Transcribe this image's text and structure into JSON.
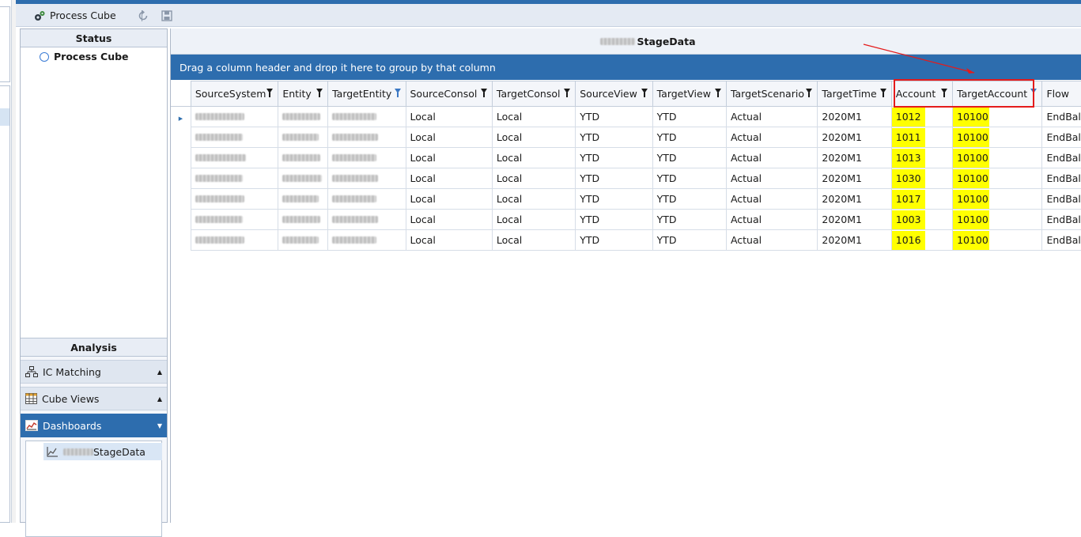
{
  "toolbar": {
    "process_cube_label": "Process Cube"
  },
  "status_panel": {
    "header": "Status",
    "item_label": "Process Cube"
  },
  "analysis_panel": {
    "header": "Analysis",
    "items": [
      {
        "label": "IC Matching",
        "icon": "network-icon"
      },
      {
        "label": "Cube Views",
        "icon": "grid-table-icon"
      },
      {
        "label": "Dashboards",
        "icon": "chart-icon"
      }
    ],
    "dashboard_item_suffix": "StageData"
  },
  "main": {
    "title_suffix": "StageData",
    "group_hint": "Drag a column header and drop it here to group by that column",
    "columns": [
      "SourceSystem",
      "Entity",
      "TargetEntity",
      "SourceConsol",
      "TargetConsol",
      "SourceView",
      "TargetView",
      "TargetScenario",
      "TargetTime",
      "Account",
      "TargetAccount",
      "Flow"
    ],
    "rows": [
      {
        "source_consol": "Local",
        "target_consol": "Local",
        "source_view": "YTD",
        "target_view": "YTD",
        "scenario": "Actual",
        "time": "2020M1",
        "account": "1012",
        "target_account": "10100",
        "flow": "EndBal"
      },
      {
        "source_consol": "Local",
        "target_consol": "Local",
        "source_view": "YTD",
        "target_view": "YTD",
        "scenario": "Actual",
        "time": "2020M1",
        "account": "1011",
        "target_account": "10100",
        "flow": "EndBal"
      },
      {
        "source_consol": "Local",
        "target_consol": "Local",
        "source_view": "YTD",
        "target_view": "YTD",
        "scenario": "Actual",
        "time": "2020M1",
        "account": "1013",
        "target_account": "10100",
        "flow": "EndBal"
      },
      {
        "source_consol": "Local",
        "target_consol": "Local",
        "source_view": "YTD",
        "target_view": "YTD",
        "scenario": "Actual",
        "time": "2020M1",
        "account": "1030",
        "target_account": "10100",
        "flow": "EndBal"
      },
      {
        "source_consol": "Local",
        "target_consol": "Local",
        "source_view": "YTD",
        "target_view": "YTD",
        "scenario": "Actual",
        "time": "2020M1",
        "account": "1017",
        "target_account": "10100",
        "flow": "EndBal"
      },
      {
        "source_consol": "Local",
        "target_consol": "Local",
        "source_view": "YTD",
        "target_view": "YTD",
        "scenario": "Actual",
        "time": "2020M1",
        "account": "1003",
        "target_account": "10100",
        "flow": "EndBal"
      },
      {
        "source_consol": "Local",
        "target_consol": "Local",
        "source_view": "YTD",
        "target_view": "YTD",
        "scenario": "Actual",
        "time": "2020M1",
        "account": "1016",
        "target_account": "10100",
        "flow": "EndBal"
      }
    ]
  },
  "colors": {
    "accent_blue": "#2d6dae",
    "highlight_yellow": "#ffff00",
    "annotation_red": "#e41b1b"
  }
}
